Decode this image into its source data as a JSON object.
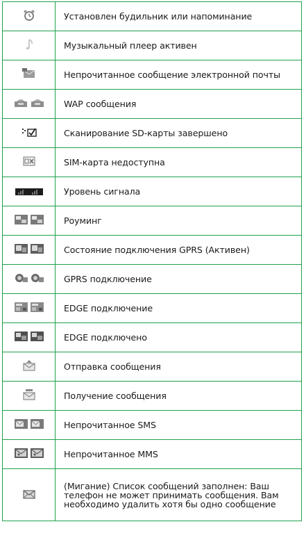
{
  "rows": [
    {
      "icon": "alarm-clock-icon",
      "text": "Установлен будильник или напоминание"
    },
    {
      "icon": "music-note-icon",
      "text": "Музыкальный плеер активен"
    },
    {
      "icon": "unread-email-icon",
      "text": "Непрочитанное сообщение электронной почты"
    },
    {
      "icon": "wap-message-icon",
      "text": "WAP сообщения"
    },
    {
      "icon": "sd-scan-done-icon",
      "text": "Сканирование SD-карты завершено"
    },
    {
      "icon": "sim-unavailable-icon",
      "text": "SIM-карта недоступна"
    },
    {
      "icon": "signal-level-icon",
      "text": "Уровень сигнала"
    },
    {
      "icon": "roaming-icon",
      "text": "Роуминг"
    },
    {
      "icon": "gprs-active-icon",
      "text": "Состояние подключения GPRS (Активен)"
    },
    {
      "icon": "gprs-connection-icon",
      "text": "GPRS подключение"
    },
    {
      "icon": "edge-connection-icon",
      "text": "EDGE подключение"
    },
    {
      "icon": "edge-connected-icon",
      "text": "EDGE подключено"
    },
    {
      "icon": "sending-message-icon",
      "text": "Отправка сообщения"
    },
    {
      "icon": "receiving-message-icon",
      "text": "Получение сообщения"
    },
    {
      "icon": "unread-sms-icon",
      "text": "Непрочитанное SMS"
    },
    {
      "icon": "unread-mms-icon",
      "text": "Непрочитанное MMS"
    },
    {
      "icon": "message-list-full-icon",
      "text": "(Мигание) Список сообщений заполнен: Ваш телефон не может принимать сообщения. Вам необходимо удалить хотя бы одно сообщение"
    }
  ],
  "colors": {
    "border": "#1fa24a",
    "icon": "#8a8a8a"
  }
}
